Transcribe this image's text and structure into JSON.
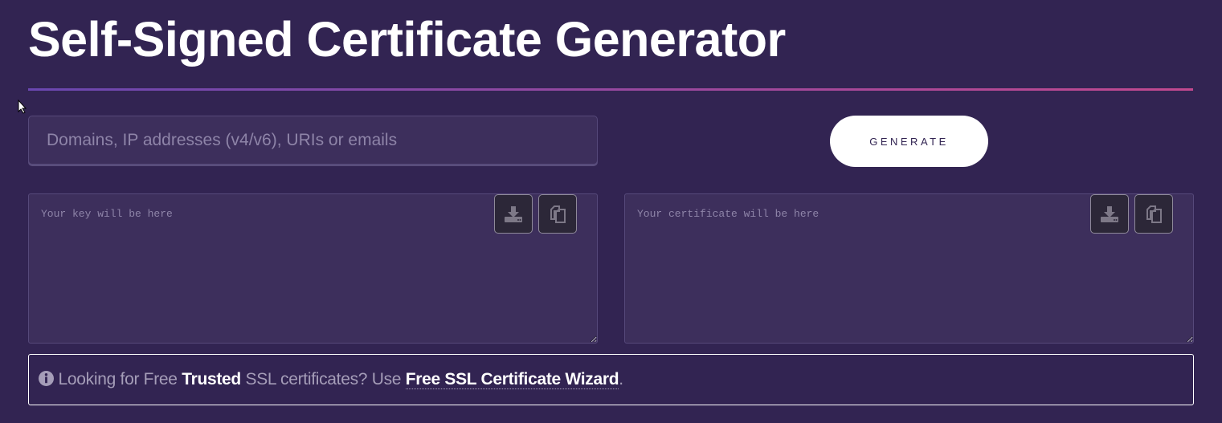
{
  "title": "Self-Signed Certificate Generator",
  "domains_placeholder": "Domains, IP addresses (v4/v6), URIs or emails",
  "generate_label": "GENERATE",
  "key_placeholder": "Your key will be here",
  "cert_placeholder": "Your certificate will be here",
  "notice": {
    "pre": "Looking for Free ",
    "bold": "Trusted",
    "mid": " SSL certificates? Use ",
    "link": "Free SSL Certificate Wizard",
    "post": "."
  },
  "colors": {
    "background": "#322452",
    "accent_start": "#6a47b0",
    "accent_end": "#c2498f"
  }
}
